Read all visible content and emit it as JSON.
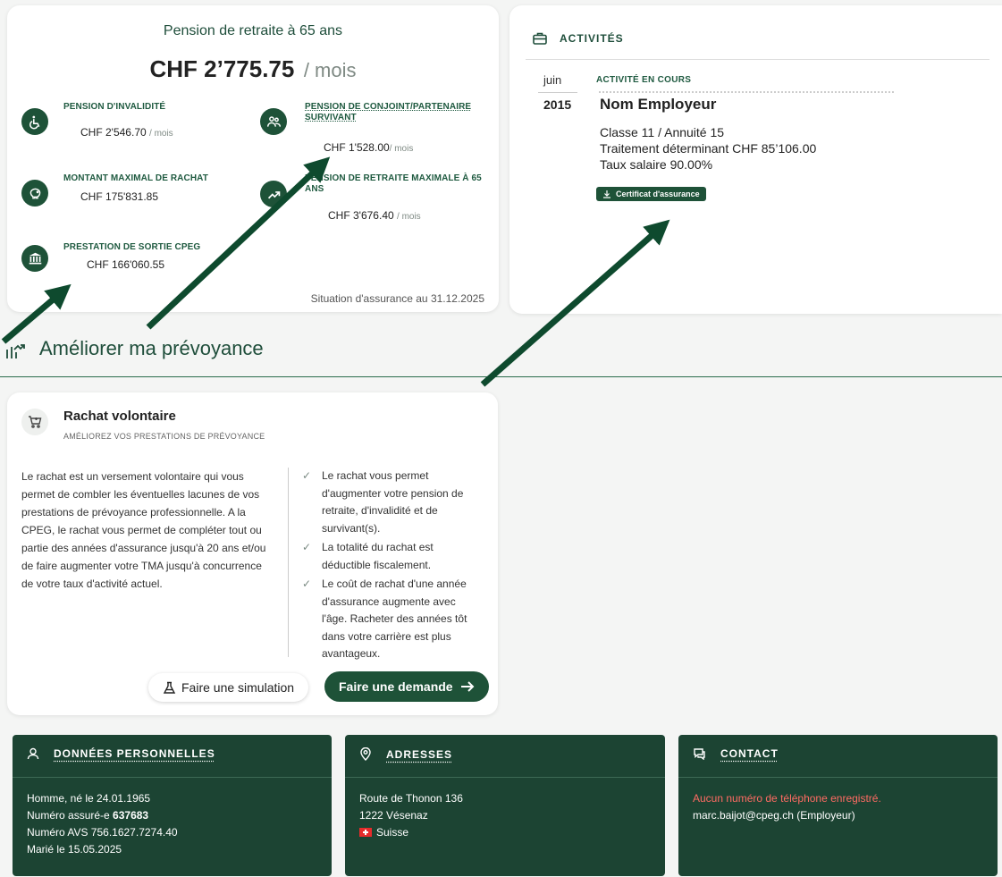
{
  "pension": {
    "title": "Pension de retraite à 65 ans",
    "amount": "CHF 2’775.75",
    "unit": "/ mois",
    "per_month": "/ mois",
    "invalidity": {
      "label": "PENSION D'INVALIDITÉ",
      "value": "CHF 2'546.70"
    },
    "survivor": {
      "label": "PENSION DE CONJOINT/PARTENAIRE SURVIVANT",
      "value": "CHF 1'528.00"
    },
    "max_buyback": {
      "label": "MONTANT MAXIMAL DE RACHAT",
      "value": "CHF 175'831.85"
    },
    "max_retirement": {
      "label": "PENSION DE RETRAITE MAXIMALE À 65 ANS",
      "value": "CHF 3'676.40"
    },
    "exit_benefit": {
      "label": "PRESTATION DE SORTIE CPEG",
      "value": "CHF 166'060.55"
    },
    "situation": "Situation d'assurance au 31.12.2025"
  },
  "activities": {
    "header": "ACTIVITÉS",
    "month": "juin",
    "year": "2015",
    "status": "ACTIVITÉ EN COURS",
    "employer": "Nom Employeur",
    "class_line": "Classe 11 / Annuité 15",
    "salary_line": "Traitement déterminant CHF 85’106.00",
    "rate_line": "Taux salaire 90.00%",
    "certificate_button": "Certificat d'assurance"
  },
  "section": {
    "title": "Améliorer ma prévoyance"
  },
  "rachat": {
    "title": "Rachat volontaire",
    "subtitle": "AMÉLIOREZ VOS PRESTATIONS DE PRÉVOYANCE",
    "description": "Le rachat est un versement volontaire qui vous permet de combler les éventuelles lacunes de vos prestations de prévoyance professionnelle. A la CPEG, le rachat vous permet de compléter tout ou partie des années d'assurance jusqu'à 20 ans et/ou de faire augmenter votre TMA jusqu'à concurrence de votre taux d'activité actuel.",
    "benefits": [
      "Le rachat vous permet d'augmenter votre pension de retraite, d'invalidité et de survivant(s).",
      "La totalité du rachat est déductible fiscalement.",
      "Le coût de rachat d'une année d'assurance augmente avec l'âge. Racheter des années tôt dans votre carrière est plus avantageux."
    ],
    "simulate_button": "Faire une simulation",
    "request_button": "Faire une demande"
  },
  "personal": {
    "header": "DONNÉES PERSONNELLES",
    "line1": "Homme, né le 24.01.1965",
    "insured_label": "Numéro assuré-e",
    "insured_number": "637683",
    "avs": "Numéro AVS 756.1627.7274.40",
    "married": "Marié le 15.05.2025"
  },
  "address": {
    "header": "ADRESSES",
    "street": "Route de Thonon 136",
    "city": "1222 Vésenaz",
    "country": "Suisse"
  },
  "contact": {
    "header": "CONTACT",
    "no_phone": "Aucun numéro de téléphone enregistré.",
    "email": "marc.baijot@cpeg.ch (Employeur)"
  },
  "colors": {
    "primary": "#1e5238",
    "dark_card": "#1c4433",
    "warning": "#ff6b63"
  },
  "icons": [
    "wheelchair-icon",
    "couple-icon",
    "piggy-bank-icon",
    "trend-up-icon",
    "bank-icon",
    "briefcase-icon",
    "growth-icon",
    "cart-icon",
    "flask-icon",
    "arrow-right-icon",
    "user-icon",
    "location-icon",
    "chat-icon",
    "download-icon",
    "swiss-flag-icon"
  ]
}
